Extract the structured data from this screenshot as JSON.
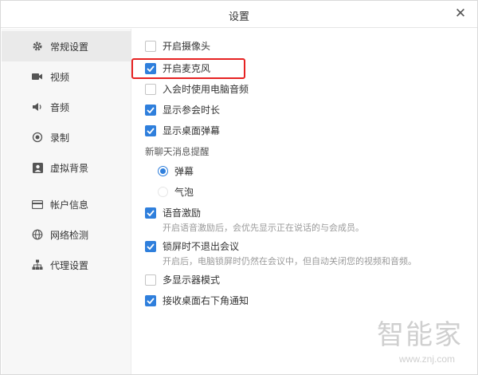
{
  "window": {
    "title": "设置",
    "close_glyph": "✕"
  },
  "sidebar": {
    "items": [
      {
        "label": "常规设置",
        "icon": "gear-icon",
        "active": true
      },
      {
        "label": "视频",
        "icon": "camera-icon",
        "active": false
      },
      {
        "label": "音频",
        "icon": "speaker-icon",
        "active": false
      },
      {
        "label": "录制",
        "icon": "record-icon",
        "active": false
      },
      {
        "label": "虚拟背景",
        "icon": "portrait-icon",
        "active": false
      },
      {
        "label": "帐户信息",
        "icon": "card-icon",
        "active": false
      },
      {
        "label": "网络检测",
        "icon": "globe-icon",
        "active": false
      },
      {
        "label": "代理设置",
        "icon": "network-icon",
        "active": false
      }
    ]
  },
  "settings": {
    "camera": {
      "label": "开启摄像头",
      "checked": false
    },
    "mic": {
      "label": "开启麦克风",
      "checked": true
    },
    "pc_audio": {
      "label": "入会时使用电脑音频",
      "checked": false
    },
    "duration": {
      "label": "显示参会时长",
      "checked": true
    },
    "danmaku": {
      "label": "显示桌面弹幕",
      "checked": true
    },
    "chat_section": "新聊天消息提醒",
    "chat_radio_danmaku": {
      "label": "弹幕",
      "selected": true
    },
    "chat_radio_bubble": {
      "label": "气泡",
      "selected": false
    },
    "voice_stimulus": {
      "label": "语音激励",
      "checked": true,
      "hint": "开启语音激励后，会优先显示正在说话的与会成员。"
    },
    "lock_screen": {
      "label": "锁屏时不退出会议",
      "checked": true,
      "hint": "开启后，电脑锁屏时仍然在会议中，但自动关闭您的视频和音频。"
    },
    "multi_display": {
      "label": "多显示器模式",
      "checked": false
    },
    "notify": {
      "label": "接收桌面右下角通知",
      "checked": true
    }
  },
  "watermark": {
    "text": "智能家",
    "url": "www.znj.com"
  },
  "colors": {
    "accent": "#2f7fdc",
    "highlight": "#e62222"
  }
}
